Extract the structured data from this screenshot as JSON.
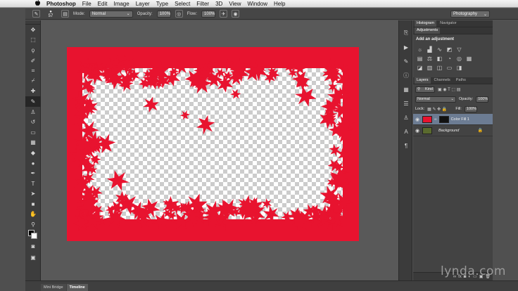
{
  "menubar": {
    "apple_icon": "apple-logo",
    "items": [
      "Photoshop",
      "File",
      "Edit",
      "Image",
      "Layer",
      "Type",
      "Select",
      "Filter",
      "3D",
      "View",
      "Window",
      "Help"
    ]
  },
  "options": {
    "brush_size": "57",
    "mode_label": "Mode:",
    "mode_value": "Normal",
    "opacity_label": "Opacity:",
    "opacity_value": "100%",
    "flow_label": "Flow:",
    "flow_value": "100%",
    "workspace": "Photography"
  },
  "panels": {
    "top_tabs": [
      "Histogram",
      "Navigator"
    ],
    "adjustments_tab": "Adjustments",
    "adjustments_title": "Add an adjustment",
    "layer_tabs": [
      "Layers",
      "Channels",
      "Paths"
    ],
    "kind_label": "Kind",
    "blend_mode": "Normal",
    "opacity_label": "Opacity:",
    "opacity_value": "100%",
    "lock_label": "Lock:",
    "fill_label": "Fill:",
    "fill_value": "100%",
    "layers": [
      {
        "name": "Color Fill 1",
        "selected": true
      },
      {
        "name": "Background",
        "selected": false
      }
    ]
  },
  "bottom_tabs": [
    "Mini Bridge",
    "Timeline"
  ],
  "artwork": {
    "border_color": "#e8132f"
  },
  "watermark": "lynda.com"
}
